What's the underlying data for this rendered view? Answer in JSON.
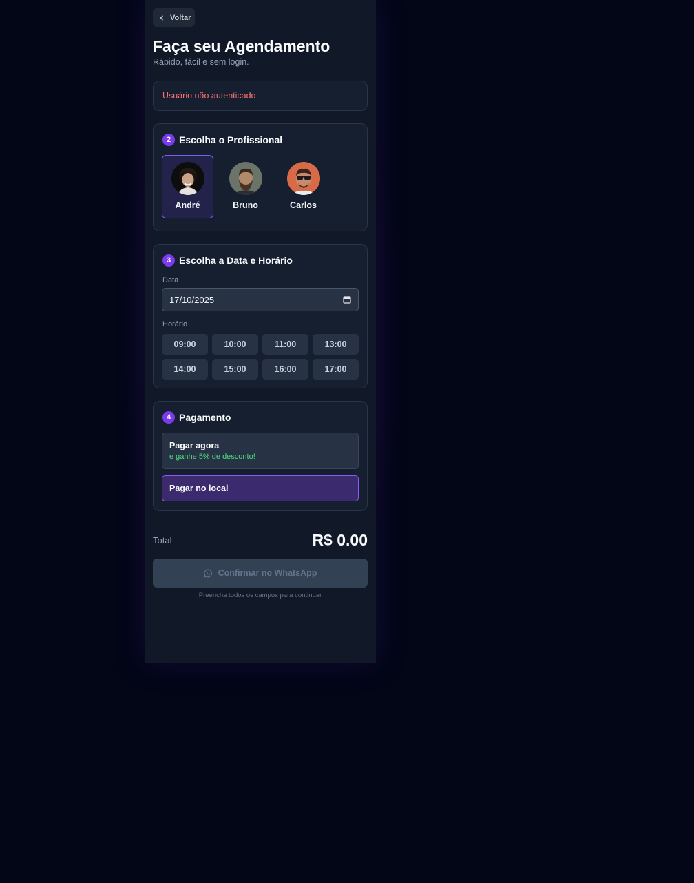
{
  "header": {
    "back_label": "Voltar",
    "title": "Faça seu Agendamento",
    "subtitle": "Rápido, fácil e sem login."
  },
  "alert": {
    "message": "Usuário não autenticado"
  },
  "professional_section": {
    "step": "2",
    "title": "Escolha o Profissional",
    "professionals": [
      {
        "name": "André",
        "selected": true
      },
      {
        "name": "Bruno",
        "selected": false
      },
      {
        "name": "Carlos",
        "selected": false
      }
    ]
  },
  "datetime_section": {
    "step": "3",
    "title": "Escolha a Data e Horário",
    "date_label": "Data",
    "date_value": "17/10/2025",
    "time_label": "Horário",
    "slots": [
      "09:00",
      "10:00",
      "11:00",
      "13:00",
      "14:00",
      "15:00",
      "16:00",
      "17:00"
    ]
  },
  "payment_section": {
    "step": "4",
    "title": "Pagamento",
    "pay_now_label": "Pagar agora",
    "pay_now_sub": "e ganhe 5% de desconto!",
    "pay_local_label": "Pagar no local",
    "selected": "Pagar no local"
  },
  "summary": {
    "total_label": "Total",
    "total_value": "R$ 0.00",
    "confirm_label": "Confirmar no WhatsApp",
    "confirm_icon": "whatsapp-icon",
    "hint": "Preencha todos os campos para continuar"
  },
  "colors": {
    "accent": "#7c3aed",
    "background": "#020617",
    "panel": "#111827",
    "error": "#f87171",
    "success": "#4ade80"
  }
}
